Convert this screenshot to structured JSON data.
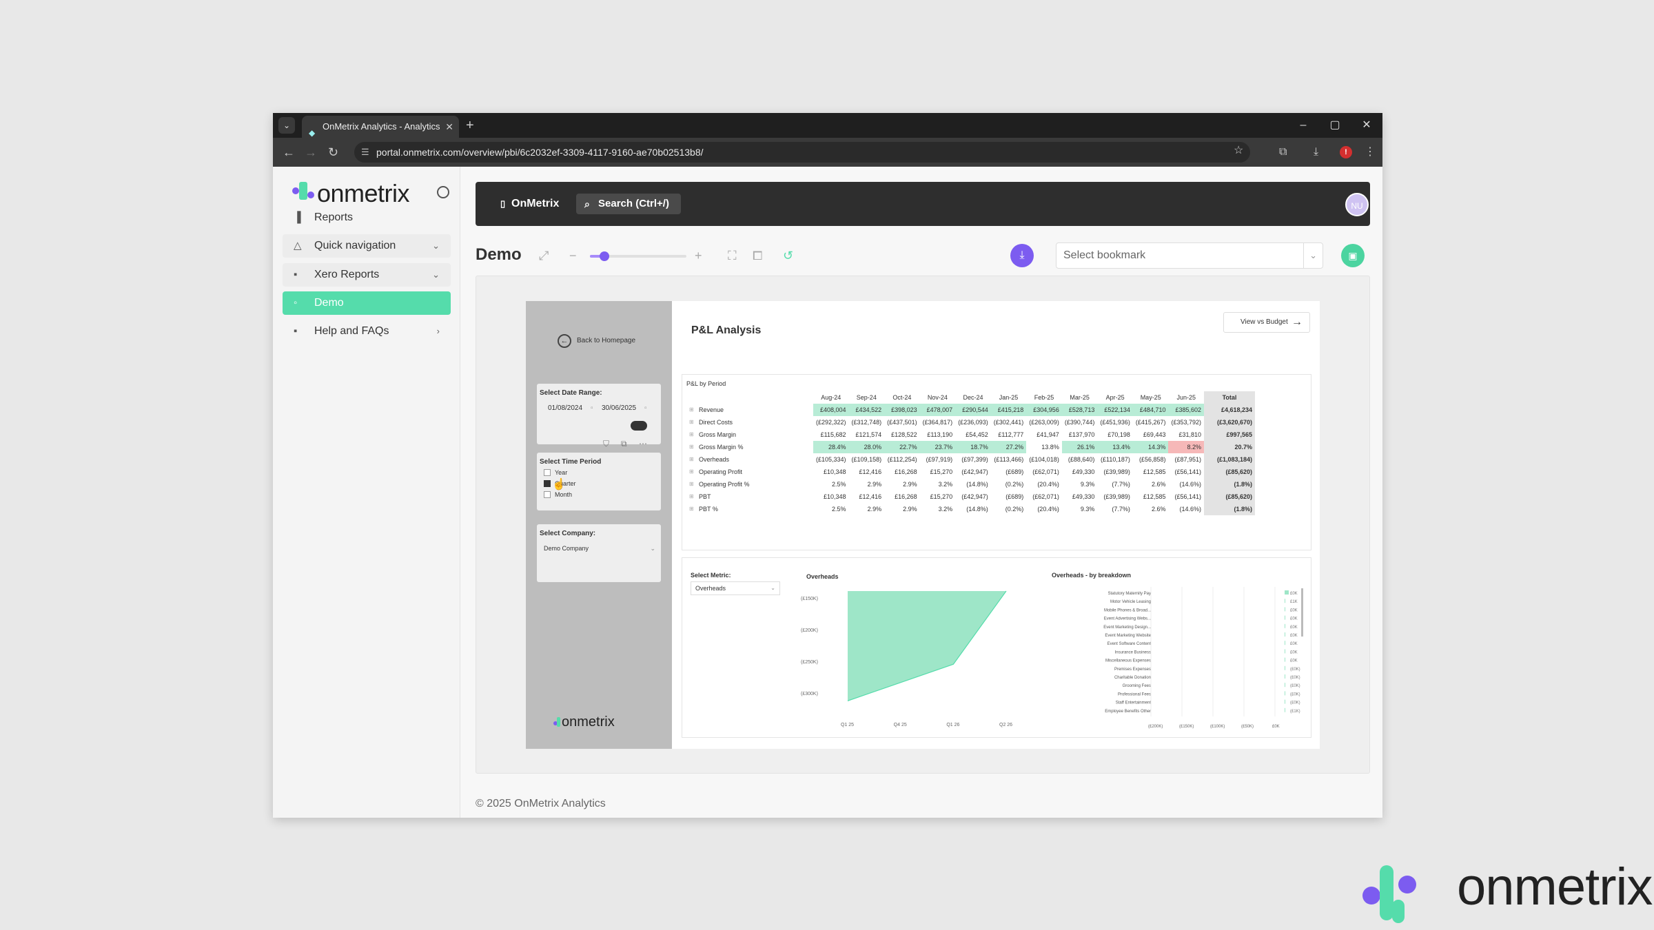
{
  "browser": {
    "tab_title": "OnMetrix Analytics - Analytics",
    "url": "portal.onmetrix.com/overview/pbi/6c2032ef-3309-4117-9160-ae70b02513b8/",
    "alert_badge": "!"
  },
  "sidebar": {
    "logo_text": "onmetrix",
    "items": [
      {
        "label": "Reports",
        "icon": "bar-chart-icon"
      },
      {
        "label": "Quick navigation",
        "icon": "navigation-icon"
      },
      {
        "label": "Xero Reports",
        "icon": "grid-icon"
      },
      {
        "label": "Demo",
        "icon": "dot-icon"
      },
      {
        "label": "Help and FAQs",
        "icon": "grid-icon"
      }
    ]
  },
  "topbar": {
    "brand": "OnMetrix",
    "search": "Search (Ctrl+/)",
    "avatar": "NU"
  },
  "toolbar": {
    "page_title": "Demo",
    "zoom_level": 0.15,
    "bookmark_placeholder": "Select bookmark"
  },
  "report": {
    "back_label": "Back to Homepage",
    "date_range": {
      "label": "Select Date Range:",
      "from": "01/08/2024",
      "to": "30/06/2025"
    },
    "time_period": {
      "label": "Select Time Period",
      "options": [
        "Year",
        "Quarter",
        "Month"
      ],
      "selected": "Quarter"
    },
    "company": {
      "label": "Select Company:",
      "value": "Demo Company"
    },
    "logo_text": "onmetrix",
    "title": "P&L Analysis",
    "view_budget": "View vs Budget",
    "table": {
      "caption": "P&L by Period",
      "columns": [
        "Aug-24",
        "Sep-24",
        "Oct-24",
        "Nov-24",
        "Dec-24",
        "Jan-25",
        "Feb-25",
        "Mar-25",
        "Apr-25",
        "May-25",
        "Jun-25",
        "Total"
      ],
      "rows": [
        {
          "label": "Revenue",
          "values": [
            "£408,004",
            "£434,522",
            "£398,023",
            "£478,007",
            "£290,544",
            "£415,218",
            "£304,956",
            "£528,713",
            "£522,134",
            "£484,710",
            "£385,602",
            "£4,618,234"
          ],
          "hl": "g"
        },
        {
          "label": "Direct Costs",
          "values": [
            "(£292,322)",
            "(£312,748)",
            "(£437,501)",
            "(£364,817)",
            "(£236,093)",
            "(£302,441)",
            "(£263,009)",
            "(£390,744)",
            "(£451,936)",
            "(£415,267)",
            "(£353,792)",
            "(£3,620,670)"
          ],
          "hl": ""
        },
        {
          "label": "Gross Margin",
          "values": [
            "£115,682",
            "£121,574",
            "£128,522",
            "£113,190",
            "£54,452",
            "£112,777",
            "£41,947",
            "£137,970",
            "£70,198",
            "£69,443",
            "£31,810",
            "£997,565"
          ],
          "hl": ""
        },
        {
          "label": "Gross Margin %",
          "values": [
            "28.4%",
            "28.0%",
            "22.7%",
            "23.7%",
            "18.7%",
            "27.2%",
            "13.8%",
            "26.1%",
            "13.4%",
            "14.3%",
            "8.2%",
            "20.7%"
          ],
          "hl": "gm"
        },
        {
          "label": "Overheads",
          "values": [
            "(£105,334)",
            "(£109,158)",
            "(£112,254)",
            "(£97,919)",
            "(£97,399)",
            "(£113,466)",
            "(£104,018)",
            "(£88,640)",
            "(£110,187)",
            "(£56,858)",
            "(£87,951)",
            "(£1,083,184)"
          ],
          "hl": ""
        },
        {
          "label": "Operating Profit",
          "values": [
            "£10,348",
            "£12,416",
            "£16,268",
            "£15,270",
            "(£42,947)",
            "(£689)",
            "(£62,071)",
            "£49,330",
            "(£39,989)",
            "£12,585",
            "(£56,141)",
            "(£85,620)"
          ],
          "hl": ""
        },
        {
          "label": "Operating Profit %",
          "values": [
            "2.5%",
            "2.9%",
            "2.9%",
            "3.2%",
            "(14.8%)",
            "(0.2%)",
            "(20.4%)",
            "9.3%",
            "(7.7%)",
            "2.6%",
            "(14.6%)",
            "(1.8%)"
          ],
          "hl": ""
        },
        {
          "label": "PBT",
          "values": [
            "£10,348",
            "£12,416",
            "£16,268",
            "£15,270",
            "(£42,947)",
            "(£689)",
            "(£62,071)",
            "£49,330",
            "(£39,989)",
            "£12,585",
            "(£56,141)",
            "(£85,620)"
          ],
          "hl": ""
        },
        {
          "label": "PBT %",
          "values": [
            "2.5%",
            "2.9%",
            "2.9%",
            "3.2%",
            "(14.8%)",
            "(0.2%)",
            "(20.4%)",
            "9.3%",
            "(7.7%)",
            "2.6%",
            "(14.6%)",
            "(1.8%)"
          ],
          "hl": ""
        }
      ]
    },
    "metric": {
      "label": "Select Metric:",
      "value": "Overheads"
    },
    "overheads_title": "Overheads",
    "breakdown_title": "Overheads - by breakdown"
  },
  "chart_data": [
    {
      "type": "area",
      "title": "Overheads",
      "categories": [
        "Q1 25",
        "Q4 25",
        "Q1 26",
        "Q2 26"
      ],
      "values": [
        -300,
        -250,
        -200,
        0
      ],
      "yticks": [
        "(£150K)",
        "(£200K)",
        "(£250K)",
        "(£300K)"
      ],
      "color": "#9ee6c8"
    },
    {
      "type": "bar",
      "title": "Overheads - by breakdown",
      "categories": [
        "Statutory Maternity Pay",
        "Motor Vehicle Leasing",
        "Mobile Phones & Broad...",
        "Event Advertising Webs...",
        "Event Marketing Design...",
        "Event Marketing Website",
        "Event Software Content",
        "Insurance Business",
        "Miscellaneous Expenses",
        "Premises Expenses",
        "Charitable Donation",
        "Grooming Fees",
        "Professional Fees",
        "Staff Entertainment",
        "Employee Benefits Other"
      ],
      "values": [
        1,
        0,
        0,
        0,
        0,
        0,
        0,
        0,
        0,
        0,
        0,
        0,
        0,
        0,
        0
      ],
      "value_labels": [
        "£0K",
        "£1K",
        "£0K",
        "£0K",
        "£0K",
        "£0K",
        "£0K",
        "£0K",
        "£0K",
        "(£0K)",
        "(£0K)",
        "(£0K)",
        "(£0K)",
        "(£0K)",
        "(£1K)"
      ],
      "xticks": [
        "(£200K)",
        "(£150K)",
        "(£100K)",
        "(£50K)",
        "£0K"
      ],
      "color": "#9ee6c8"
    }
  ],
  "footer": "© 2025 OnMetrix Analytics",
  "corner_logo": "onmetrix",
  "colors": {
    "accent": "#55dcab",
    "purple": "#7c5cf0"
  }
}
